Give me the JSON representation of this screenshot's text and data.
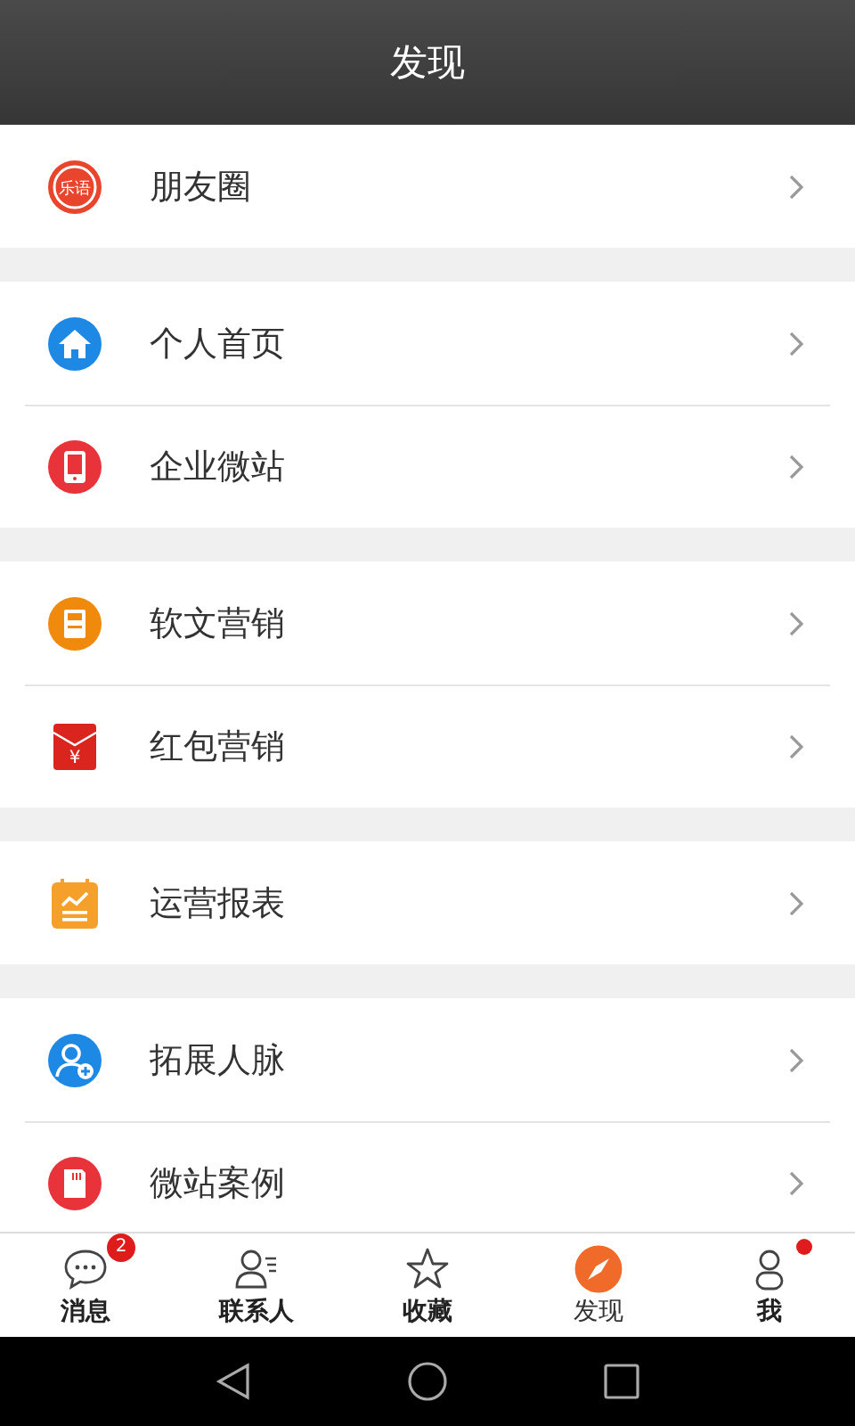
{
  "header": {
    "title": "发现"
  },
  "groups": [
    {
      "items": [
        {
          "label": "朋友圈",
          "kind": "logo",
          "icon_text": "乐语"
        }
      ]
    },
    {
      "items": [
        {
          "label": "个人首页",
          "kind": "home"
        },
        {
          "label": "企业微站",
          "kind": "tablet"
        }
      ]
    },
    {
      "items": [
        {
          "label": "软文营销",
          "kind": "document"
        },
        {
          "label": "红包营销",
          "kind": "envelope",
          "icon_text": "¥"
        }
      ]
    },
    {
      "items": [
        {
          "label": "运营报表",
          "kind": "chart"
        }
      ]
    },
    {
      "items": [
        {
          "label": "拓展人脉",
          "kind": "adduser"
        },
        {
          "label": "微站案例",
          "kind": "card"
        }
      ]
    }
  ],
  "tab_bar": [
    {
      "label": "消息",
      "kind": "chat",
      "selected": false,
      "badge": "2"
    },
    {
      "label": "联系人",
      "kind": "contacts",
      "selected": false
    },
    {
      "label": "收藏",
      "kind": "star",
      "selected": false
    },
    {
      "label": "发现",
      "kind": "compass",
      "selected": true
    },
    {
      "label": "我",
      "kind": "person",
      "selected": false,
      "dot": true
    }
  ]
}
